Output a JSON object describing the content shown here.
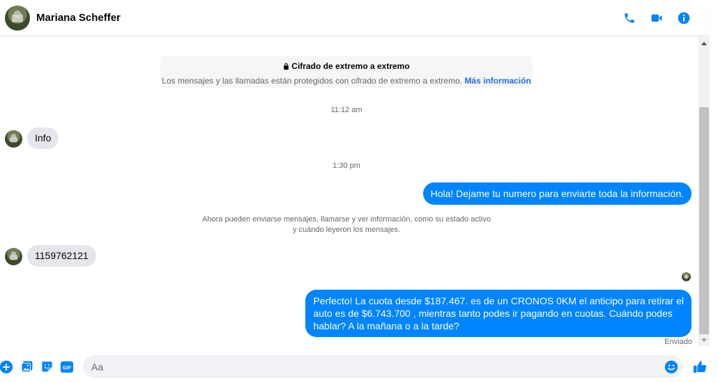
{
  "header": {
    "contact_name": "Mariana Scheffer"
  },
  "icons": {
    "call": "phone-icon",
    "video": "video-camera-icon",
    "info": "info-icon",
    "lock": "lock-icon",
    "add": "plus-circle-icon",
    "image": "image-icon",
    "sticker": "sticker-icon",
    "gif": "gif-icon",
    "emoji": "smile-icon",
    "like": "thumbs-up-icon"
  },
  "colors": {
    "accent": "#0084ff",
    "incoming_bubble": "#e4e6eb",
    "link": "#216fdb"
  },
  "encryption": {
    "title": "Cifrado de extremo a extremo",
    "body": "Los mensajes y las llamadas están protegidos con cifrado de extremo a extremo.",
    "link": "Más información"
  },
  "messages": {
    "ts1": "11:12 am",
    "msg1": "Info",
    "ts2": "1:30 pm",
    "msg2": "Hola! Dejame tu numero  para enviarte toda la información.",
    "notice_line1": "Ahora pueden enviarse mensajes, llamarse y ver información, como su estado activo",
    "notice_line2": "y cuándo leyeron los mensajes.",
    "msg3": "1159762121",
    "msg4_line1": "Perfecto! La cuota desde $187.467. es de un CRONOS 0KM el anticipo para retirar el",
    "msg4_line2": "auto es de $6.743.700 , mientras tanto podes ir pagando en cuotas. Cuándo podes",
    "msg4_line3": "hablar? A la mañana o a la tarde?",
    "status": "Enviado"
  },
  "composer": {
    "placeholder": "Aa",
    "gif_label": "GIF"
  }
}
